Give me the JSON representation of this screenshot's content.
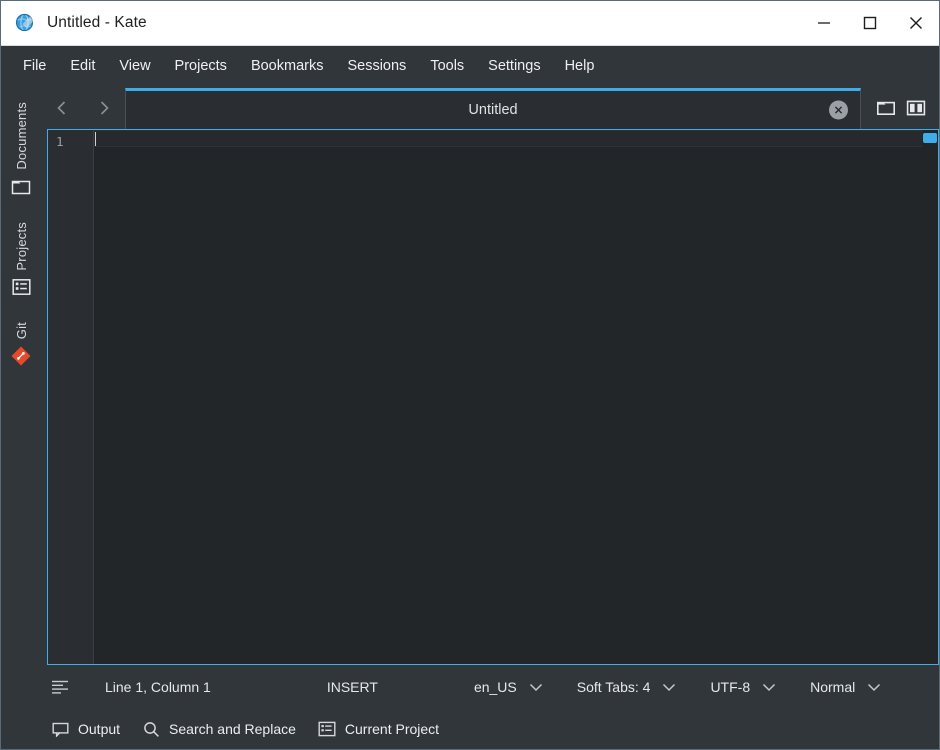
{
  "window": {
    "title": "Untitled  - Kate",
    "app_icon": "kate-globe-icon",
    "controls": {
      "minimize": "minimize-icon",
      "maximize": "maximize-icon",
      "close": "close-icon"
    }
  },
  "menubar": {
    "items": [
      {
        "label": "File"
      },
      {
        "label": "Edit"
      },
      {
        "label": "View"
      },
      {
        "label": "Projects"
      },
      {
        "label": "Bookmarks"
      },
      {
        "label": "Sessions"
      },
      {
        "label": "Tools"
      },
      {
        "label": "Settings"
      },
      {
        "label": "Help"
      }
    ]
  },
  "sidebar": {
    "items": [
      {
        "label": "Documents",
        "icon": "folder-icon"
      },
      {
        "label": "Projects",
        "icon": "project-list-icon"
      },
      {
        "label": "Git",
        "icon": "git-diamond-icon"
      }
    ]
  },
  "tabbar": {
    "back": "chevron-left-icon",
    "forward": "chevron-right-icon",
    "tabs": [
      {
        "title": "Untitled",
        "active": true,
        "close": "close-circle-icon"
      }
    ],
    "tools": [
      {
        "name": "open-document-button",
        "icon": "folder-open-icon"
      },
      {
        "name": "split-view-button",
        "icon": "split-view-icon"
      }
    ]
  },
  "editor": {
    "line_numbers": [
      "1"
    ],
    "content": "",
    "accent": "#3daee9"
  },
  "statusbar": {
    "align_icon": "text-align-icon",
    "cursor_position": "Line 1, Column 1",
    "input_mode": "INSERT",
    "language": "en_US",
    "indentation": "Soft Tabs: 4",
    "encoding": "UTF-8",
    "highlight_mode": "Normal"
  },
  "bottombar": {
    "items": [
      {
        "label": "Output",
        "icon": "speech-bubble-icon"
      },
      {
        "label": "Search and Replace",
        "icon": "search-icon"
      },
      {
        "label": "Current Project",
        "icon": "project-list-icon"
      }
    ]
  }
}
